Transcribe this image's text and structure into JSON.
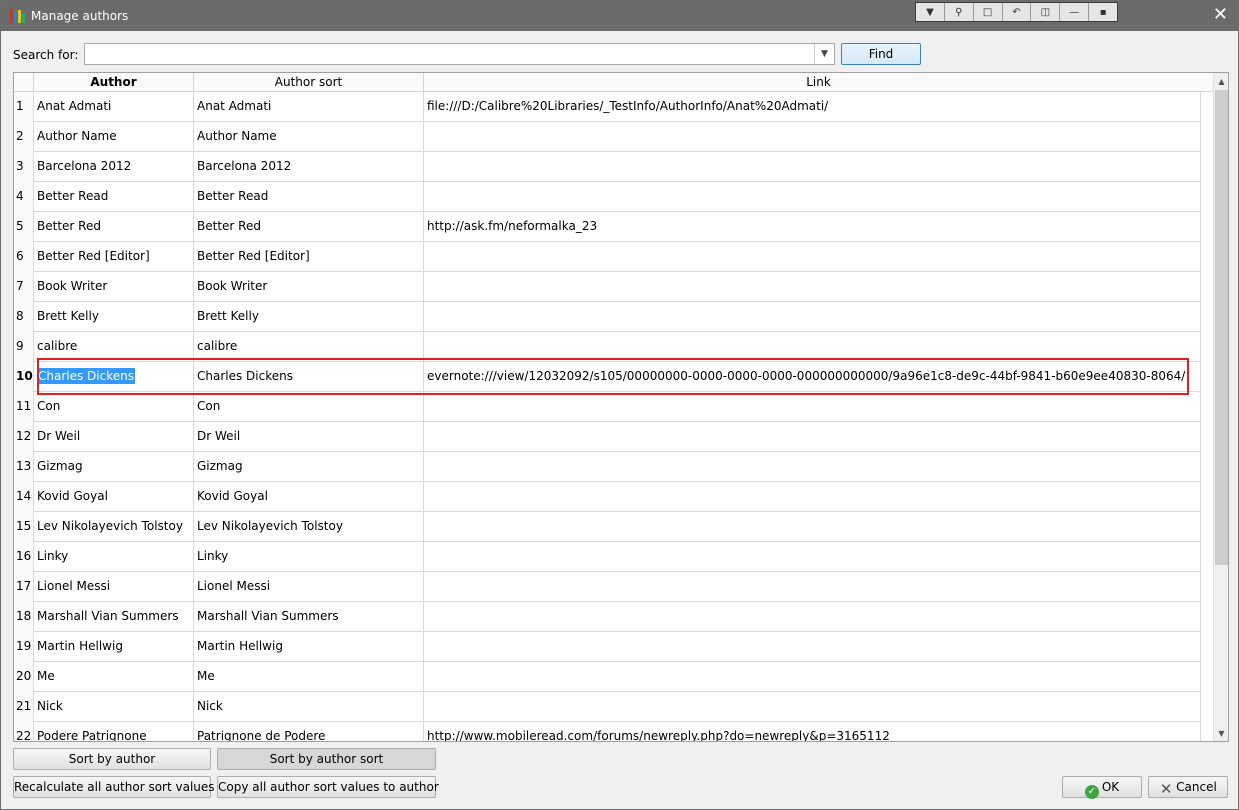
{
  "window": {
    "title": "Manage authors",
    "app_icon": "calibre-books-icon",
    "close_glyph": "✕"
  },
  "toolbar_strip": {
    "icons": [
      "collapse-icon",
      "pin-icon",
      "restore-icon",
      "undo-icon",
      "lock-icon",
      "minimize-icon",
      "dot-icon"
    ]
  },
  "search": {
    "label": "Search for:",
    "value": "",
    "placeholder": "",
    "find_label": "Find"
  },
  "table": {
    "columns": [
      "Author",
      "Author sort",
      "Link"
    ],
    "current_row": 10,
    "rows": [
      {
        "n": "1",
        "author": "Anat Admati",
        "sort": "Anat Admati",
        "link": "file:///D:/Calibre%20Libraries/_TestInfo/AuthorInfo/Anat%20Admati/"
      },
      {
        "n": "2",
        "author": "Author Name",
        "sort": "Author Name",
        "link": ""
      },
      {
        "n": "3",
        "author": "Barcelona 2012",
        "sort": "Barcelona 2012",
        "link": ""
      },
      {
        "n": "4",
        "author": "Better Read",
        "sort": "Better Read",
        "link": ""
      },
      {
        "n": "5",
        "author": "Better Red",
        "sort": "Better Red",
        "link": "http://ask.fm/neformalka_23"
      },
      {
        "n": "6",
        "author": "Better Red [Editor]",
        "sort": "Better Red [Editor]",
        "link": ""
      },
      {
        "n": "7",
        "author": "Book Writer",
        "sort": "Book Writer",
        "link": ""
      },
      {
        "n": "8",
        "author": "Brett Kelly",
        "sort": "Brett Kelly",
        "link": ""
      },
      {
        "n": "9",
        "author": "calibre",
        "sort": "calibre",
        "link": ""
      },
      {
        "n": "10",
        "author": "Charles Dickens",
        "sort": "Charles Dickens",
        "link": "evernote:///view/12032092/s105/00000000-0000-0000-0000-000000000000/9a96e1c8-de9c-44bf-9841-b60e9ee40830-8064/"
      },
      {
        "n": "11",
        "author": "Con",
        "sort": "Con",
        "link": ""
      },
      {
        "n": "12",
        "author": "Dr Weil",
        "sort": "Dr Weil",
        "link": ""
      },
      {
        "n": "13",
        "author": "Gizmag",
        "sort": "Gizmag",
        "link": ""
      },
      {
        "n": "14",
        "author": "Kovid Goyal",
        "sort": "Kovid Goyal",
        "link": ""
      },
      {
        "n": "15",
        "author": "Lev Nikolayevich Tolstoy",
        "sort": "Lev Nikolayevich Tolstoy",
        "link": ""
      },
      {
        "n": "16",
        "author": "Linky",
        "sort": "Linky",
        "link": ""
      },
      {
        "n": "17",
        "author": "Lionel Messi",
        "sort": "Lionel Messi",
        "link": ""
      },
      {
        "n": "18",
        "author": "Marshall Vian Summers",
        "sort": "Marshall Vian Summers",
        "link": ""
      },
      {
        "n": "19",
        "author": "Martin Hellwig",
        "sort": "Martin Hellwig",
        "link": ""
      },
      {
        "n": "20",
        "author": "Me",
        "sort": "Me",
        "link": ""
      },
      {
        "n": "21",
        "author": "Nick",
        "sort": "Nick",
        "link": ""
      },
      {
        "n": "22",
        "author": "Podere Patrignone",
        "sort": "Patrignone de Podere",
        "link": "http://www.mobileread.com/forums/newreply.php?do=newreply&p=3165112"
      }
    ]
  },
  "buttons": {
    "sort_by_author": "Sort by author",
    "sort_by_author_sort": "Sort by author sort",
    "recalculate": "Recalculate all author sort values",
    "copy_sort": "Copy all author sort values to author",
    "ok": "OK",
    "cancel": "Cancel"
  },
  "colors": {
    "selection": "#3399ff",
    "highlight_box": "#e02020",
    "titlebar": "#6b6b6b"
  }
}
